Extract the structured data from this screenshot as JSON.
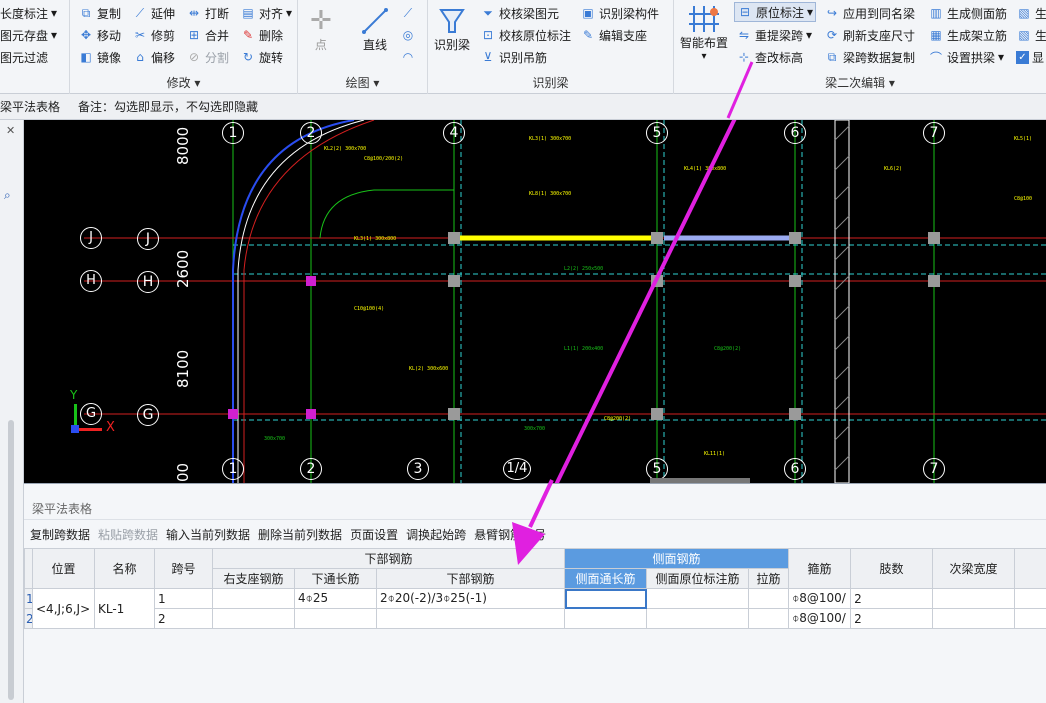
{
  "ribbon": {
    "edit_left": [
      "长度标注",
      "图元存盘",
      "图元过滤"
    ],
    "modify": {
      "col1": [
        "复制",
        "移动",
        "镜像"
      ],
      "col2": [
        "延伸",
        "修剪",
        "偏移"
      ],
      "col3": [
        "打断",
        "合并",
        "分割"
      ],
      "col4": [
        "对齐",
        "删除",
        "旋转"
      ],
      "label": "修改"
    },
    "draw": {
      "point": "点",
      "line": "直线",
      "label": "绘图"
    },
    "identify": {
      "big": "识别梁",
      "col1": [
        "校核梁图元",
        "校核原位标注",
        "识别吊筋"
      ],
      "col2": [
        "识别梁构件",
        "编辑支座"
      ],
      "label": "识别梁"
    },
    "secondary": {
      "big": "智能布置",
      "col1": [
        "原位标注",
        "重提梁跨",
        "查改标高"
      ],
      "col2": [
        "应用到同名梁",
        "刷新支座尺寸",
        "梁跨数据复制"
      ],
      "col3": [
        "生成侧面筋",
        "生成架立筋",
        "设置拱梁"
      ],
      "col4": [
        "生",
        "生",
        "显"
      ],
      "label": "梁二次编辑"
    }
  },
  "hintbar": {
    "title": "梁平法表格",
    "note": "备注：勾选即显示，不勾选即隐藏"
  },
  "drawing": {
    "axes_top": [
      "1",
      "2",
      "4",
      "5",
      "6",
      "7"
    ],
    "axes_bottom": [
      "1",
      "2",
      "3",
      "1/4",
      "5",
      "6",
      "7"
    ],
    "axes_left": [
      "J",
      "H",
      "G"
    ],
    "dims": [
      "8000",
      "2600",
      "8100",
      "00"
    ],
    "axis_x": "X",
    "axis_y": "Y"
  },
  "panel": {
    "title": "梁平法表格",
    "toolbar": [
      "复制跨数据",
      "粘贴跨数据",
      "输入当前列数据",
      "删除当前列数据",
      "页面设置",
      "调换起始跨",
      "悬臂钢筋代号"
    ],
    "toolbar_disabled": [
      false,
      true,
      false,
      false,
      false,
      false,
      false
    ],
    "header_groups": {
      "bottom": "下部钢筋",
      "side": "侧面钢筋"
    },
    "columns": {
      "position": "位置",
      "name": "名称",
      "span": "跨号",
      "right_support": "右支座钢筋",
      "bottom_through": "下通长筋",
      "bottom_bar": "下部钢筋",
      "side_through": "侧面通长筋",
      "side_original": "侧面原位标注筋",
      "tie": "拉筋",
      "stirrup": "箍筋",
      "legs": "肢数",
      "secondary_width": "次梁宽度"
    },
    "rows": [
      {
        "num": "1",
        "position": "<4,J;6,J>",
        "name": "KL-1",
        "span": "1",
        "right_support": "",
        "bottom_through": "4⌽25",
        "bottom_bar": "2⌽20(-2)/3⌽25(-1)",
        "side_through": "",
        "side_original": "",
        "tie": "",
        "stirrup": "⌽8@100/",
        "legs": "2",
        "secondary_width": ""
      },
      {
        "num": "2",
        "position": "",
        "name": "",
        "span": "2",
        "right_support": "",
        "bottom_through": "",
        "bottom_bar": "",
        "side_through": "",
        "side_original": "",
        "tie": "",
        "stirrup": "⌽8@100/",
        "legs": "2",
        "secondary_width": ""
      }
    ]
  },
  "colors": {
    "accent": "#5b9be0",
    "arrow": "#e020e0",
    "canvas": "#000000"
  }
}
